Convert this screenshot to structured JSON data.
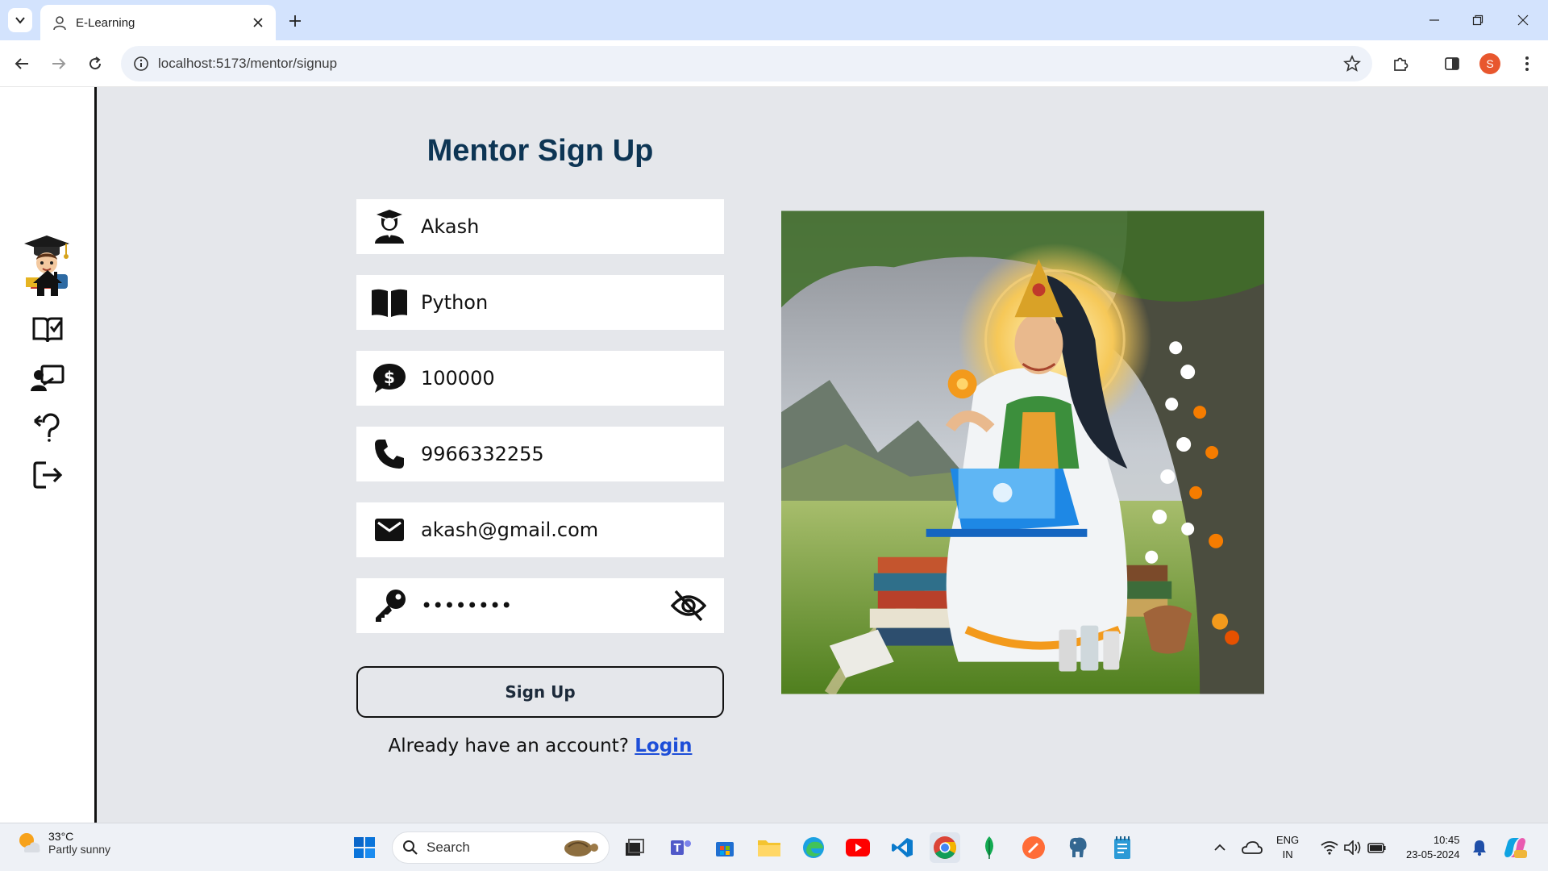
{
  "browser": {
    "tab_title": "E-Learning",
    "url": "localhost:5173/mentor/signup",
    "profile_initial": "S"
  },
  "sidebar": {
    "items": [
      {
        "name": "home",
        "icon": "home-icon"
      },
      {
        "name": "courses",
        "icon": "book-check-icon"
      },
      {
        "name": "mentors",
        "icon": "teacher-board-icon"
      },
      {
        "name": "help",
        "icon": "question-return-icon"
      },
      {
        "name": "logout",
        "icon": "logout-icon"
      }
    ]
  },
  "form": {
    "title": "Mentor Sign Up",
    "name_value": "Akash",
    "course_value": "Python",
    "fee_value": "100000",
    "phone_value": "9966332255",
    "email_value": "akash@gmail.com",
    "password_value": "••••••••",
    "submit_label": "Sign Up",
    "login_prompt": "Already have an account?",
    "login_link": "Login"
  },
  "taskbar": {
    "temperature": "33°C",
    "condition": "Partly sunny",
    "search_label": "Search",
    "lang_line1": "ENG",
    "lang_line2": "IN",
    "time": "10:45",
    "date": "23-05-2024"
  },
  "colors": {
    "title": "#0d3554",
    "link": "#1d4ed8",
    "page_bg": "#e5e7eb",
    "tabstrip": "#d3e3fd"
  }
}
